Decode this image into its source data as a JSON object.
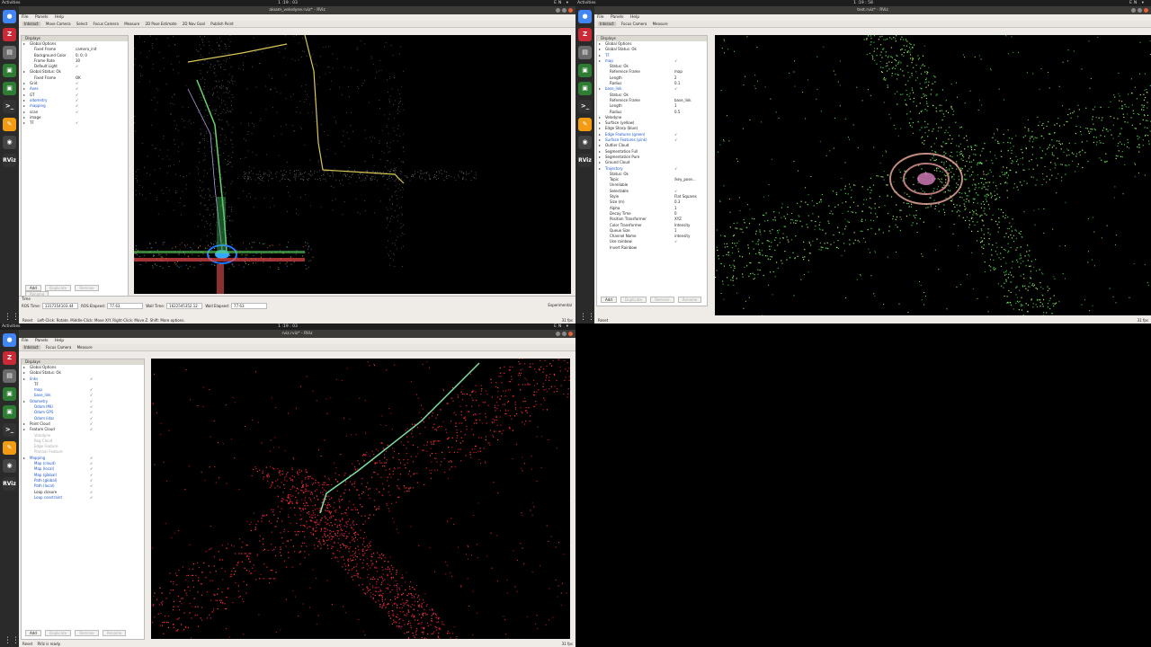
{
  "screens": {
    "topleft": {
      "topbar": {
        "activities": "Activities",
        "app": "rviz",
        "clock": "1 :19 : 03",
        "lang": "EN"
      },
      "window_title": "aloam_velodyne.rviz* - RViz",
      "menu": [
        "File",
        "Panels",
        "Help"
      ],
      "toolbar": [
        "Interact",
        "Move Camera",
        "Select",
        "Focus Camera",
        "Measure",
        "2D Pose Estimate",
        "2D Nav Goal",
        "Publish Point"
      ],
      "displays_title": "Displays",
      "tree": [
        {
          "label": "Global Options",
          "value": "",
          "indent": 1
        },
        {
          "label": "Fixed Frame",
          "value": "camera_init",
          "indent": 2
        },
        {
          "label": "Background Color",
          "value": "0; 0; 0",
          "indent": 2
        },
        {
          "label": "Frame Rate",
          "value": "30",
          "indent": 2
        },
        {
          "label": "Default Light",
          "value": "✓",
          "indent": 2
        },
        {
          "label": "Global Status: Ok",
          "value": "",
          "indent": 1
        },
        {
          "label": "Fixed Frame",
          "value": "OK",
          "indent": 2
        },
        {
          "label": "Grid",
          "value": "✓",
          "indent": 1
        },
        {
          "label": "Axes",
          "value": "✓",
          "indent": 1,
          "blue": true
        },
        {
          "label": "GT",
          "value": "✓",
          "indent": 1
        },
        {
          "label": "odometry",
          "value": "✓",
          "indent": 1,
          "blue": true
        },
        {
          "label": "mapping",
          "value": "✓",
          "indent": 1,
          "blue": true
        },
        {
          "label": "scan",
          "value": "✓",
          "indent": 1
        },
        {
          "label": "image",
          "value": "",
          "indent": 1
        },
        {
          "label": "TF",
          "value": "✓",
          "indent": 1
        }
      ],
      "buttons": {
        "add": "Add",
        "duplicate": "Duplicate",
        "remove": "Remove",
        "rename": "Rename"
      },
      "time": {
        "title": "Time",
        "ros_time_label": "ROS Time:",
        "ros_time": "1317354103.44",
        "ros_elapsed_label": "ROS Elapsed:",
        "ros_elapsed": "77.63",
        "wall_time_label": "Wall Time:",
        "wall_time": "1622545352.12",
        "wall_elapsed_label": "Wall Elapsed:",
        "wall_elapsed": "77.63",
        "experimental": "Experimental"
      },
      "status": {
        "reset": "Reset",
        "hint": "Left-Click: Rotate. Middle-Click: Move X/Y. Right-Click: Move Z. Shift: More options.",
        "fps": "31 fps"
      }
    },
    "topright": {
      "topbar": {
        "activities": "Activities",
        "app": "rviz",
        "clock": "1 :19 : 58",
        "lang": "EN"
      },
      "window_title": "test.rviz* - RViz",
      "menu": [
        "File",
        "Panels",
        "Help"
      ],
      "toolbar": [
        "Interact",
        "Focus Camera",
        "Measure"
      ],
      "displays_title": "Displays",
      "tree": [
        {
          "label": "Global Options",
          "value": "",
          "indent": 1
        },
        {
          "label": "Global Status: Ok",
          "value": "",
          "indent": 1
        },
        {
          "label": "TF",
          "value": "",
          "indent": 1,
          "blue": true
        },
        {
          "label": "map",
          "value": "✓",
          "indent": 1,
          "blue": true
        },
        {
          "label": "Status: Ok",
          "value": "",
          "indent": 2
        },
        {
          "label": "Reference Frame",
          "value": "map",
          "indent": 2
        },
        {
          "label": "Length",
          "value": "2",
          "indent": 2
        },
        {
          "label": "Radius",
          "value": "0.1",
          "indent": 2
        },
        {
          "label": "base_link",
          "value": "✓",
          "indent": 1,
          "blue": true
        },
        {
          "label": "Status: Ok",
          "value": "",
          "indent": 2
        },
        {
          "label": "Reference Frame",
          "value": "base_link",
          "indent": 2
        },
        {
          "label": "Length",
          "value": "1",
          "indent": 2
        },
        {
          "label": "Radius",
          "value": "0.5",
          "indent": 2
        },
        {
          "label": "Velodyne",
          "value": "",
          "indent": 1
        },
        {
          "label": "Surface (yellow)",
          "value": "",
          "indent": 1
        },
        {
          "label": "Edge Sharp (blue)",
          "value": "",
          "indent": 1
        },
        {
          "label": "Edge Features (green)",
          "value": "✓",
          "indent": 1,
          "blue": true
        },
        {
          "label": "Surface Features (pink)",
          "value": "✓",
          "indent": 1,
          "blue": true
        },
        {
          "label": "Outlier Cloud",
          "value": "",
          "indent": 1
        },
        {
          "label": "Segmentation Full",
          "value": "",
          "indent": 1
        },
        {
          "label": "Segmentation Pure",
          "value": "",
          "indent": 1
        },
        {
          "label": "Ground Cloud",
          "value": "",
          "indent": 1
        },
        {
          "label": "Trajectory",
          "value": "✓",
          "indent": 1,
          "blue": true
        },
        {
          "label": "Status: Ok",
          "value": "",
          "indent": 2
        },
        {
          "label": "Topic",
          "value": "/key_pose...",
          "indent": 2
        },
        {
          "label": "Unreliable",
          "value": "",
          "indent": 2
        },
        {
          "label": "Selectable",
          "value": "✓",
          "indent": 2
        },
        {
          "label": "Style",
          "value": "Flat Squares",
          "indent": 2
        },
        {
          "label": "Size (m)",
          "value": "0.3",
          "indent": 2
        },
        {
          "label": "Alpha",
          "value": "1",
          "indent": 2
        },
        {
          "label": "Decay Time",
          "value": "0",
          "indent": 2
        },
        {
          "label": "Position Transformer",
          "value": "XYZ",
          "indent": 2
        },
        {
          "label": "Color Transformer",
          "value": "Intensity",
          "indent": 2
        },
        {
          "label": "Queue Size",
          "value": "1",
          "indent": 2
        },
        {
          "label": "Channel Name",
          "value": "intensity",
          "indent": 2
        },
        {
          "label": "Use rainbow",
          "value": "✓",
          "indent": 2
        },
        {
          "label": "Invert Rainbow",
          "value": "",
          "indent": 2
        }
      ],
      "buttons": {
        "add": "Add",
        "duplicate": "Duplicate",
        "remove": "Remove",
        "rename": "Rename"
      },
      "status": {
        "reset": "Reset",
        "hint": "",
        "fps": "31 fps"
      }
    },
    "bottomleft": {
      "topbar": {
        "activities": "Activities",
        "app": "rviz",
        "clock": "1 :19 : 03",
        "lang": "EN"
      },
      "window_title": "rviz.rviz* - RViz",
      "menu": [
        "File",
        "Panels",
        "Help"
      ],
      "toolbar": [
        "Interact",
        "Focus Camera",
        "Measure"
      ],
      "displays_title": "Displays",
      "tree": [
        {
          "label": "Global Options",
          "value": "",
          "indent": 1
        },
        {
          "label": "Global Status: Ok",
          "value": "",
          "indent": 1
        },
        {
          "label": "links",
          "value": "✓",
          "indent": 1,
          "blue": true
        },
        {
          "label": "TF",
          "value": "",
          "indent": 2
        },
        {
          "label": "map",
          "value": "✓",
          "indent": 2,
          "blue": true
        },
        {
          "label": "base_link",
          "value": "✓",
          "indent": 2,
          "blue": true
        },
        {
          "label": "Odometry",
          "value": "✓",
          "indent": 1,
          "blue": true
        },
        {
          "label": "Odom IMU",
          "value": "✓",
          "indent": 2,
          "blue": true
        },
        {
          "label": "Odom GPS",
          "value": "✓",
          "indent": 2,
          "blue": true
        },
        {
          "label": "Odom lidar",
          "value": "✓",
          "indent": 2,
          "blue": true
        },
        {
          "label": "Point Cloud",
          "value": "✓",
          "indent": 1
        },
        {
          "label": "Feature Cloud",
          "value": "✓",
          "indent": 1
        },
        {
          "label": "Velodyne",
          "value": "",
          "indent": 2,
          "grey": true
        },
        {
          "label": "Reg Cloud",
          "value": "",
          "indent": 2,
          "grey": true
        },
        {
          "label": "Edge Feature",
          "value": "",
          "indent": 2,
          "grey": true
        },
        {
          "label": "Plannar Feature",
          "value": "",
          "indent": 2,
          "grey": true
        },
        {
          "label": "Mapping",
          "value": "✓",
          "indent": 1,
          "blue": true
        },
        {
          "label": "Map (cloud)",
          "value": "✓",
          "indent": 2,
          "blue": true
        },
        {
          "label": "Map (local)",
          "value": "✓",
          "indent": 2,
          "blue": true
        },
        {
          "label": "Map (global)",
          "value": "✓",
          "indent": 2,
          "blue": true
        },
        {
          "label": "Path (global)",
          "value": "✓",
          "indent": 2,
          "blue": true
        },
        {
          "label": "Path (local)",
          "value": "✓",
          "indent": 2,
          "blue": true
        },
        {
          "label": "Loop closure",
          "value": "✓",
          "indent": 2
        },
        {
          "label": "Loop constraint",
          "value": "✓",
          "indent": 2,
          "blue": true
        }
      ],
      "buttons": {
        "add": "Add",
        "duplicate": "Duplicate",
        "remove": "Remove",
        "rename": "Rename"
      },
      "status": {
        "reset": "Reset",
        "hint": "RViz is ready.",
        "fps": "31 fps"
      }
    }
  },
  "dock_icons": [
    "chrome-icon",
    "zotero-icon",
    "files-icon",
    "terminal-icon",
    "terminal-icon",
    "terminal-icon",
    "terminal-icon",
    "text-editor-icon",
    "text-editor-icon",
    "obs-icon",
    "rviz-icon"
  ],
  "dock_labels": {
    "rviz": "RViz"
  },
  "colors": {
    "dock_bg": "#2a2a2a",
    "titlebar": "#3c3b37",
    "close": "#e8603c",
    "link_blue": "#1a56c9"
  }
}
